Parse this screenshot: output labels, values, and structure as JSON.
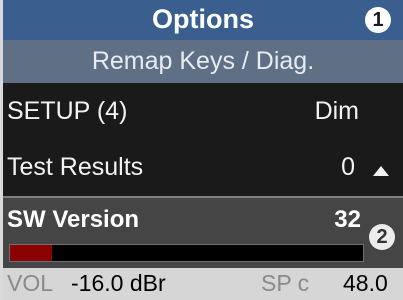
{
  "header": {
    "title": "Options",
    "badge": "1"
  },
  "subheader": {
    "text": "Remap Keys / Diag."
  },
  "rows": [
    {
      "label": "SETUP (4)",
      "value": "Dim"
    },
    {
      "label": "Test Results",
      "value": "0"
    }
  ],
  "sw_version": {
    "label": "SW Version",
    "value": "32",
    "badge": "2",
    "progress": 0.12
  },
  "footer": {
    "vol_label": "VOL",
    "vol_value": "-16.0 dBr",
    "sp_label": "SP c",
    "sp_value": "48.0"
  },
  "colors": {
    "header": "#3a5f8f",
    "subheader": "#5f6f86",
    "progress": "#8b0000"
  }
}
